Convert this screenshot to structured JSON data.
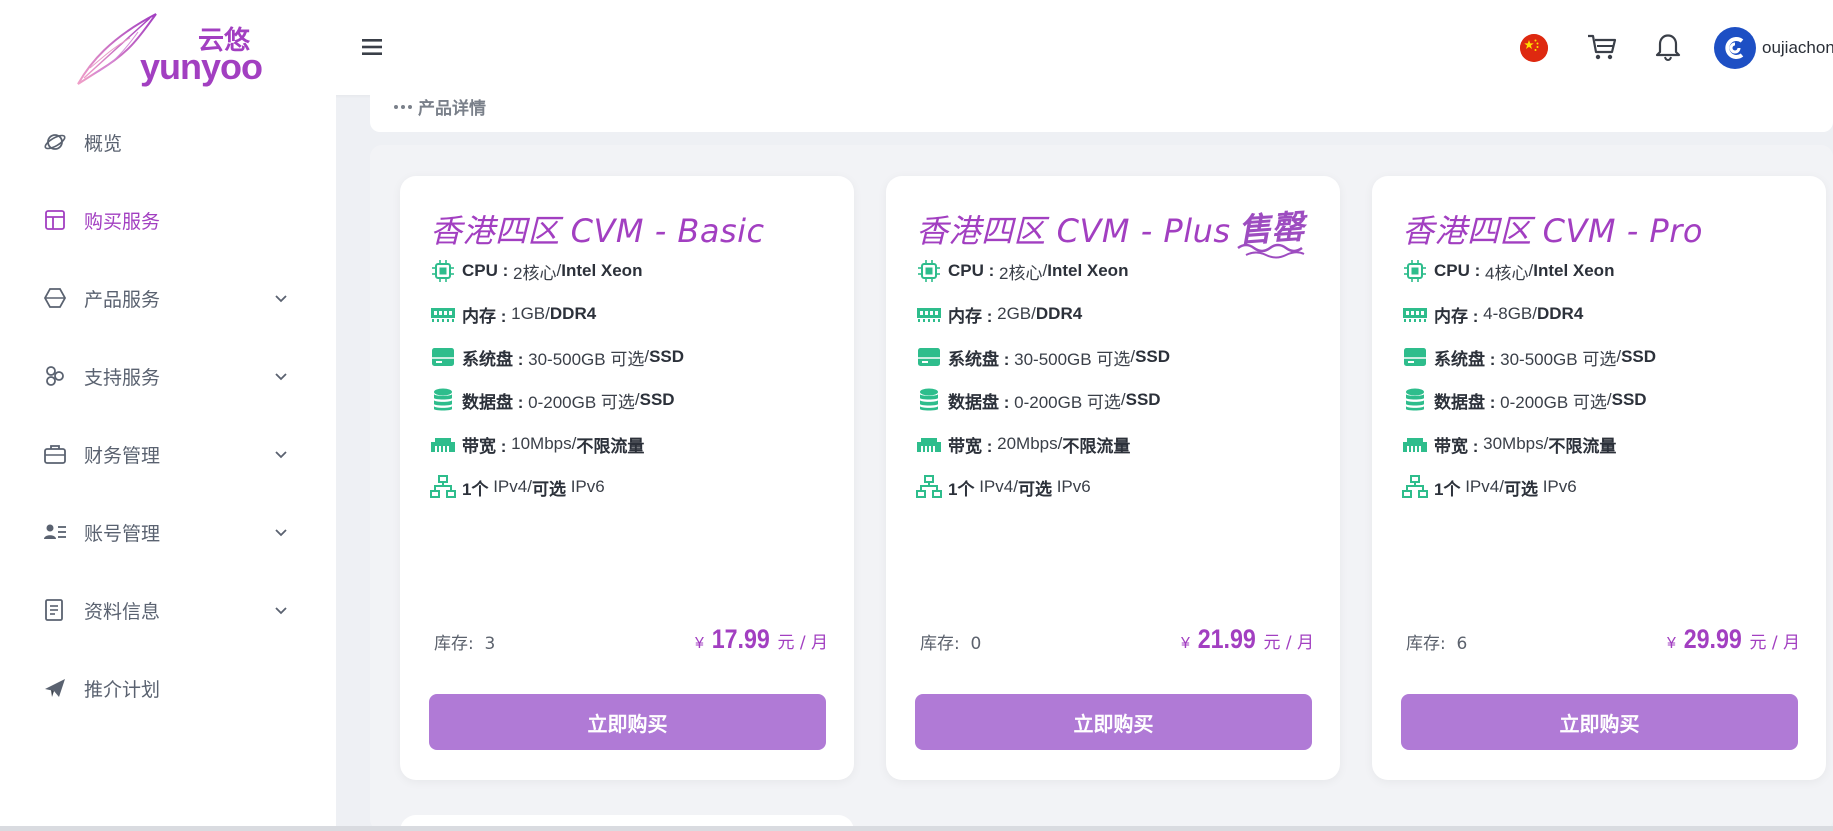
{
  "brand": {
    "logo_text_cn": "云悠",
    "logo_text_en": "yunyoo",
    "colors": {
      "primary": "#a23fc1",
      "button": "#b07ad6",
      "icon": "#2ebd8c"
    }
  },
  "topbar": {
    "menu_icon": "hamburger-icon",
    "language_flag": "china-flag-icon",
    "cart_icon": "cart-icon",
    "notification_icon": "bell-icon",
    "username": "oujiachon"
  },
  "sidebar": {
    "items": [
      {
        "label": "概览",
        "icon": "planet-icon",
        "active": false,
        "expandable": false
      },
      {
        "label": "购买服务",
        "icon": "layout-icon",
        "active": true,
        "expandable": false
      },
      {
        "label": "产品服务",
        "icon": "hexagon-icon",
        "active": false,
        "expandable": true
      },
      {
        "label": "支持服务",
        "icon": "support-icon",
        "active": false,
        "expandable": true
      },
      {
        "label": "财务管理",
        "icon": "briefcase-icon",
        "active": false,
        "expandable": true
      },
      {
        "label": "账号管理",
        "icon": "user-list-icon",
        "active": false,
        "expandable": true
      },
      {
        "label": "资料信息",
        "icon": "document-icon",
        "active": false,
        "expandable": true
      },
      {
        "label": "推介计划",
        "icon": "paper-plane-icon",
        "active": false,
        "expandable": false
      }
    ]
  },
  "breadcrumb": {
    "label": "产品详情"
  },
  "products": [
    {
      "title": "香港四区 CVM - Basic",
      "sold_out": false,
      "specs": {
        "cpu": {
          "label": "CPU :",
          "value": "2核心",
          "sep": " / ",
          "detail": "Intel Xeon"
        },
        "ram": {
          "label": "内存 :",
          "value": "1GB",
          "sep": " / ",
          "detail": "DDR4"
        },
        "sys": {
          "label": "系统盘 :",
          "value": "30-500GB 可选",
          "sep": " / ",
          "detail": "SSD"
        },
        "data": {
          "label": "数据盘 :",
          "value": "0-200GB 可选",
          "sep": " / ",
          "detail": "SSD"
        },
        "bw": {
          "label": "带宽 :",
          "value": "10Mbps",
          "sep": " / ",
          "detail": "不限流量"
        },
        "ip": {
          "count": "1个",
          "v4": "IPv4",
          "sep": " / ",
          "opt": "可选",
          "v6": "IPv6"
        }
      },
      "stock_label": "库存:",
      "stock": "3",
      "currency": "¥",
      "price": "17.99",
      "unit": "元 / 月",
      "button": "立即购买"
    },
    {
      "title": "香港四区 CVM - Plus",
      "sold_out": true,
      "sold_out_label": "售罄",
      "specs": {
        "cpu": {
          "label": "CPU :",
          "value": "2核心",
          "sep": " / ",
          "detail": "Intel Xeon"
        },
        "ram": {
          "label": "内存 :",
          "value": "2GB",
          "sep": " / ",
          "detail": "DDR4"
        },
        "sys": {
          "label": "系统盘 :",
          "value": "30-500GB 可选",
          "sep": " / ",
          "detail": "SSD"
        },
        "data": {
          "label": "数据盘 :",
          "value": "0-200GB 可选",
          "sep": " / ",
          "detail": "SSD"
        },
        "bw": {
          "label": "带宽 :",
          "value": "20Mbps",
          "sep": " / ",
          "detail": "不限流量"
        },
        "ip": {
          "count": "1个",
          "v4": "IPv4",
          "sep": " / ",
          "opt": "可选",
          "v6": "IPv6"
        }
      },
      "stock_label": "库存:",
      "stock": "0",
      "currency": "¥",
      "price": "21.99",
      "unit": "元 / 月",
      "button": "立即购买"
    },
    {
      "title": "香港四区 CVM - Pro",
      "sold_out": false,
      "specs": {
        "cpu": {
          "label": "CPU :",
          "value": "4核心",
          "sep": " / ",
          "detail": "Intel Xeon"
        },
        "ram": {
          "label": "内存 :",
          "value": "4-8GB",
          "sep": " / ",
          "detail": "DDR4"
        },
        "sys": {
          "label": "系统盘 :",
          "value": "30-500GB 可选",
          "sep": " / ",
          "detail": "SSD"
        },
        "data": {
          "label": "数据盘 :",
          "value": "0-200GB 可选",
          "sep": " / ",
          "detail": "SSD"
        },
        "bw": {
          "label": "带宽 :",
          "value": "30Mbps",
          "sep": " / ",
          "detail": "不限流量"
        },
        "ip": {
          "count": "1个",
          "v4": "IPv4",
          "sep": " / ",
          "opt": "可选",
          "v6": "IPv6"
        }
      },
      "stock_label": "库存:",
      "stock": "6",
      "currency": "¥",
      "price": "29.99",
      "unit": "元 / 月",
      "button": "立即购买"
    }
  ]
}
